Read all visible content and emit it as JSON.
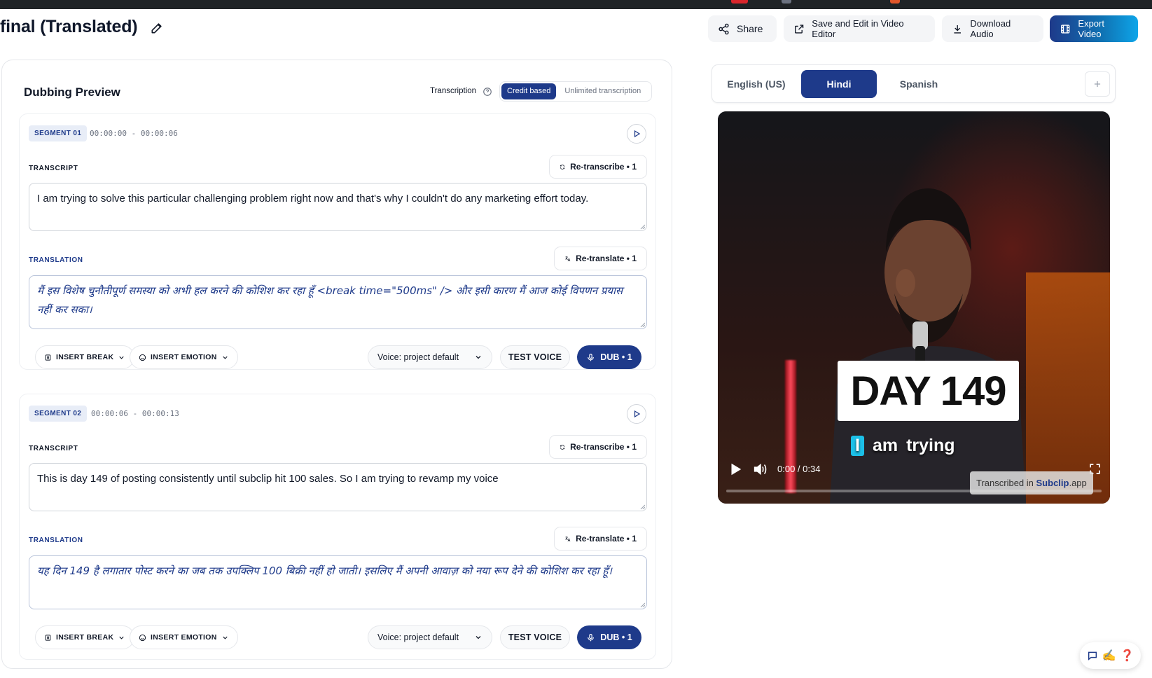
{
  "page": {
    "title": "final (Translated)"
  },
  "toolbar": {
    "share_label": "Share",
    "save_edit_label": "Save and Edit in Video Editor",
    "download_audio_label": "Download Audio",
    "export_video_label": "Export Video"
  },
  "dubbing": {
    "title": "Dubbing Preview",
    "transcription_label": "Transcription",
    "transcription_options": [
      "Credit based",
      "Unlimited transcription"
    ],
    "transcription_selected": "Credit based"
  },
  "segments": [
    {
      "badge": "SEGMENT 01",
      "time": "00:00:00 - 00:00:06",
      "transcript_label": "TRANSCRIPT",
      "retranscribe_label": "Re-transcribe • 1",
      "transcript": "I am trying to solve this particular challenging problem right now and that's why I couldn't do any marketing effort today.",
      "translation_label": "TRANSLATION",
      "retranslate_label": "Re-translate • 1",
      "translation": "मैं इस विशेष चुनौतीपूर्ण समस्या को अभी हल करने की कोशिश कर रहा हूँ <break time=\"500ms\" /> और इसी कारण मैं आज कोई विपणन प्रयास नहीं कर सका।",
      "insert_break_label": "INSERT BREAK",
      "insert_emotion_label": "INSERT EMOTION",
      "voice_label": "Voice: project default",
      "test_voice_label": "TEST VOICE",
      "dub_label": "DUB • 1"
    },
    {
      "badge": "SEGMENT 02",
      "time": "00:00:06 - 00:00:13",
      "transcript_label": "TRANSCRIPT",
      "retranscribe_label": "Re-transcribe • 1",
      "transcript": "This is day 149 of posting consistently until subclip hit 100 sales. So I am trying to revamp my voice",
      "translation_label": "TRANSLATION",
      "retranslate_label": "Re-translate • 1",
      "translation": "यह दिन 149 है लगातार पोस्ट करने का जब तक उपक्लिप 100 बिक्री नहीं हो जाती। इसलिए मैं अपनी आवाज़ को नया रूप देने की कोशिश कर रहा हूँ।",
      "insert_break_label": "INSERT BREAK",
      "insert_emotion_label": "INSERT EMOTION",
      "voice_label": "Voice: project default",
      "test_voice_label": "TEST VOICE",
      "dub_label": "DUB • 1"
    }
  ],
  "languages": {
    "tabs": [
      "English (US)",
      "Hindi",
      "Spanish"
    ],
    "active": "Hindi",
    "add_icon": "plus-icon"
  },
  "video": {
    "overlay_title": "DAY 149",
    "caption_words": [
      "I",
      "am",
      "trying"
    ],
    "caption_highlight": "I",
    "time": "0:00 / 0:34",
    "progress": 0,
    "watermark_prefix": "Transcribed in ",
    "watermark_brand": "Subclip",
    "watermark_suffix": ".app"
  },
  "help": {
    "emoji": "✍️",
    "question": "❓"
  },
  "colors": {
    "primary": "#1e3a8a",
    "accent_gradient_end": "#0ea5e9",
    "caption_highlight": "#1cc0e8"
  }
}
